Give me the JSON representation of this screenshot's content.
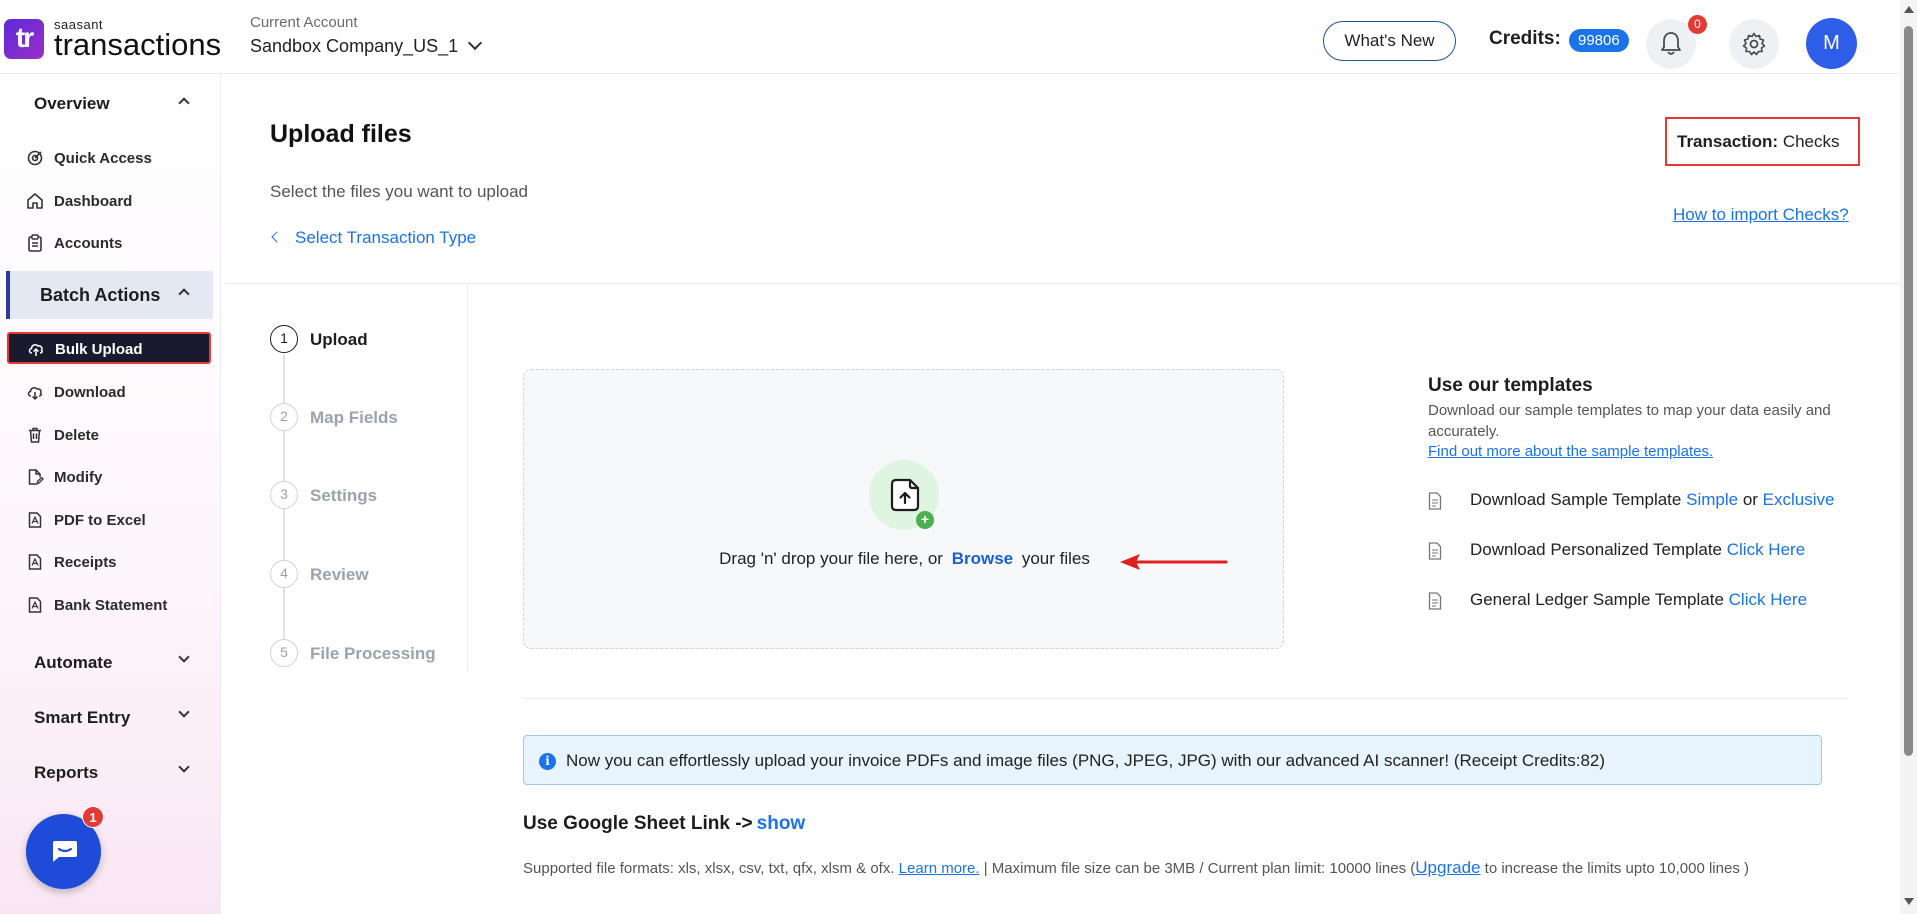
{
  "brand": {
    "logo_mark": "tr",
    "logo_small": "saasant",
    "logo_big": "transactions"
  },
  "header": {
    "account_label": "Current Account",
    "account_name": "Sandbox Company_US_1",
    "whats_new": "What's New",
    "credits_label": "Credits:",
    "credits_value": "99806",
    "notifications_count": "0",
    "avatar_initial": "M",
    "icons": [
      "bell-icon",
      "gear-icon",
      "chevron-down-icon"
    ]
  },
  "sidebar": {
    "overview": "Overview",
    "quick_access": "Quick Access",
    "dashboard": "Dashboard",
    "accounts": "Accounts",
    "batch_actions": "Batch Actions",
    "bulk_upload": "Bulk Upload",
    "download": "Download",
    "delete": "Delete",
    "modify": "Modify",
    "pdf_to_excel": "PDF to Excel",
    "receipts": "Receipts",
    "bank_statement": "Bank Statement",
    "automate": "Automate",
    "smart_entry": "Smart Entry",
    "reports": "Reports",
    "chat_badge": "1"
  },
  "main": {
    "title": "Upload files",
    "subtitle": "Select the files you want to upload",
    "back_link": "Select Transaction Type",
    "transaction_label": "Transaction:",
    "transaction_value": "Checks",
    "how_to_link": "How to import Checks?"
  },
  "steps": [
    {
      "num": "1",
      "label": "Upload"
    },
    {
      "num": "2",
      "label": "Map Fields"
    },
    {
      "num": "3",
      "label": "Settings"
    },
    {
      "num": "4",
      "label": "Review"
    },
    {
      "num": "5",
      "label": "File Processing"
    }
  ],
  "dropzone": {
    "text_before": "Drag 'n' drop your file here, or",
    "browse": "Browse",
    "text_after": "your files",
    "plus": "+"
  },
  "templates": {
    "title": "Use our templates",
    "description": "Download our sample templates to map your data easily and accurately.",
    "more_link": "Find out more about the sample templates.",
    "row1_text": "Download Sample Template",
    "row1_simple": "Simple",
    "row1_or": "or",
    "row1_exclusive": "Exclusive",
    "row2_text": "Download Personalized Template",
    "row2_link": "Click Here",
    "row3_text": "General Ledger Sample Template",
    "row3_link": "Click Here"
  },
  "info": {
    "icon": "i",
    "text": "Now you can effortlessly upload your invoice PDFs and image files (PNG, JPEG, JPG) with our advanced AI scanner! (Receipt Credits:82)"
  },
  "google_sheet": {
    "label": "Use Google Sheet Link ->",
    "show": "show"
  },
  "formats": {
    "text1": "Supported file formats: xls, xlsx, csv, txt, qfx, xlsm & ofx.",
    "learn_more": "Learn more.",
    "text2": " |  Maximum file size can be 3MB / Current plan limit: 10000 lines (",
    "upgrade": "Upgrade",
    "text3": " to increase the limits upto 10,000 lines )"
  },
  "colors": {
    "accent": "#1a73e8",
    "highlight_border": "#e53935",
    "brand_purple": "#5b2bd6"
  }
}
